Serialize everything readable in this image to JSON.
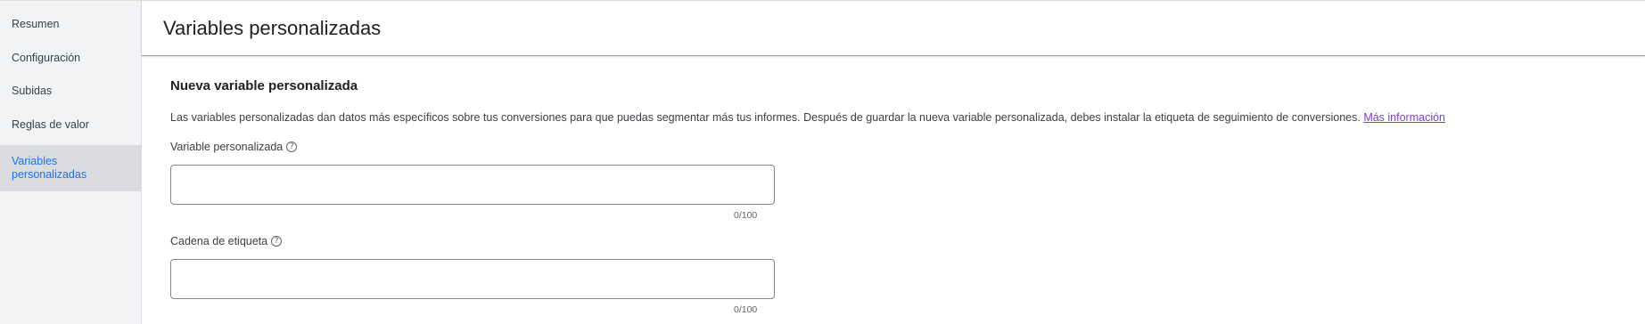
{
  "sidebar": {
    "items": [
      {
        "label": "Resumen"
      },
      {
        "label": "Configuración"
      },
      {
        "label": "Subidas"
      },
      {
        "label": "Reglas de valor"
      },
      {
        "label": "Variables personalizadas",
        "active": true
      }
    ]
  },
  "header": {
    "title": "Variables personalizadas"
  },
  "form": {
    "section_title": "Nueva variable personalizada",
    "description": "Las variables personalizadas dan datos más específicos sobre tus conversiones para que puedas segmentar más tus informes. Después de guardar la nueva variable personalizada, debes instalar la etiqueta de seguimiento de conversiones.",
    "learn_more": "Más información",
    "help_glyph": "?",
    "fields": [
      {
        "label": "Variable personalizada",
        "value": "",
        "counter": "0/100"
      },
      {
        "label": "Cadena de etiqueta",
        "value": "",
        "counter": "0/100"
      }
    ]
  },
  "colors": {
    "accent": "#1a73e8",
    "link": "#7b3fd1",
    "sidebar_bg": "#f1f3f4",
    "active_bg": "#dadce0"
  }
}
